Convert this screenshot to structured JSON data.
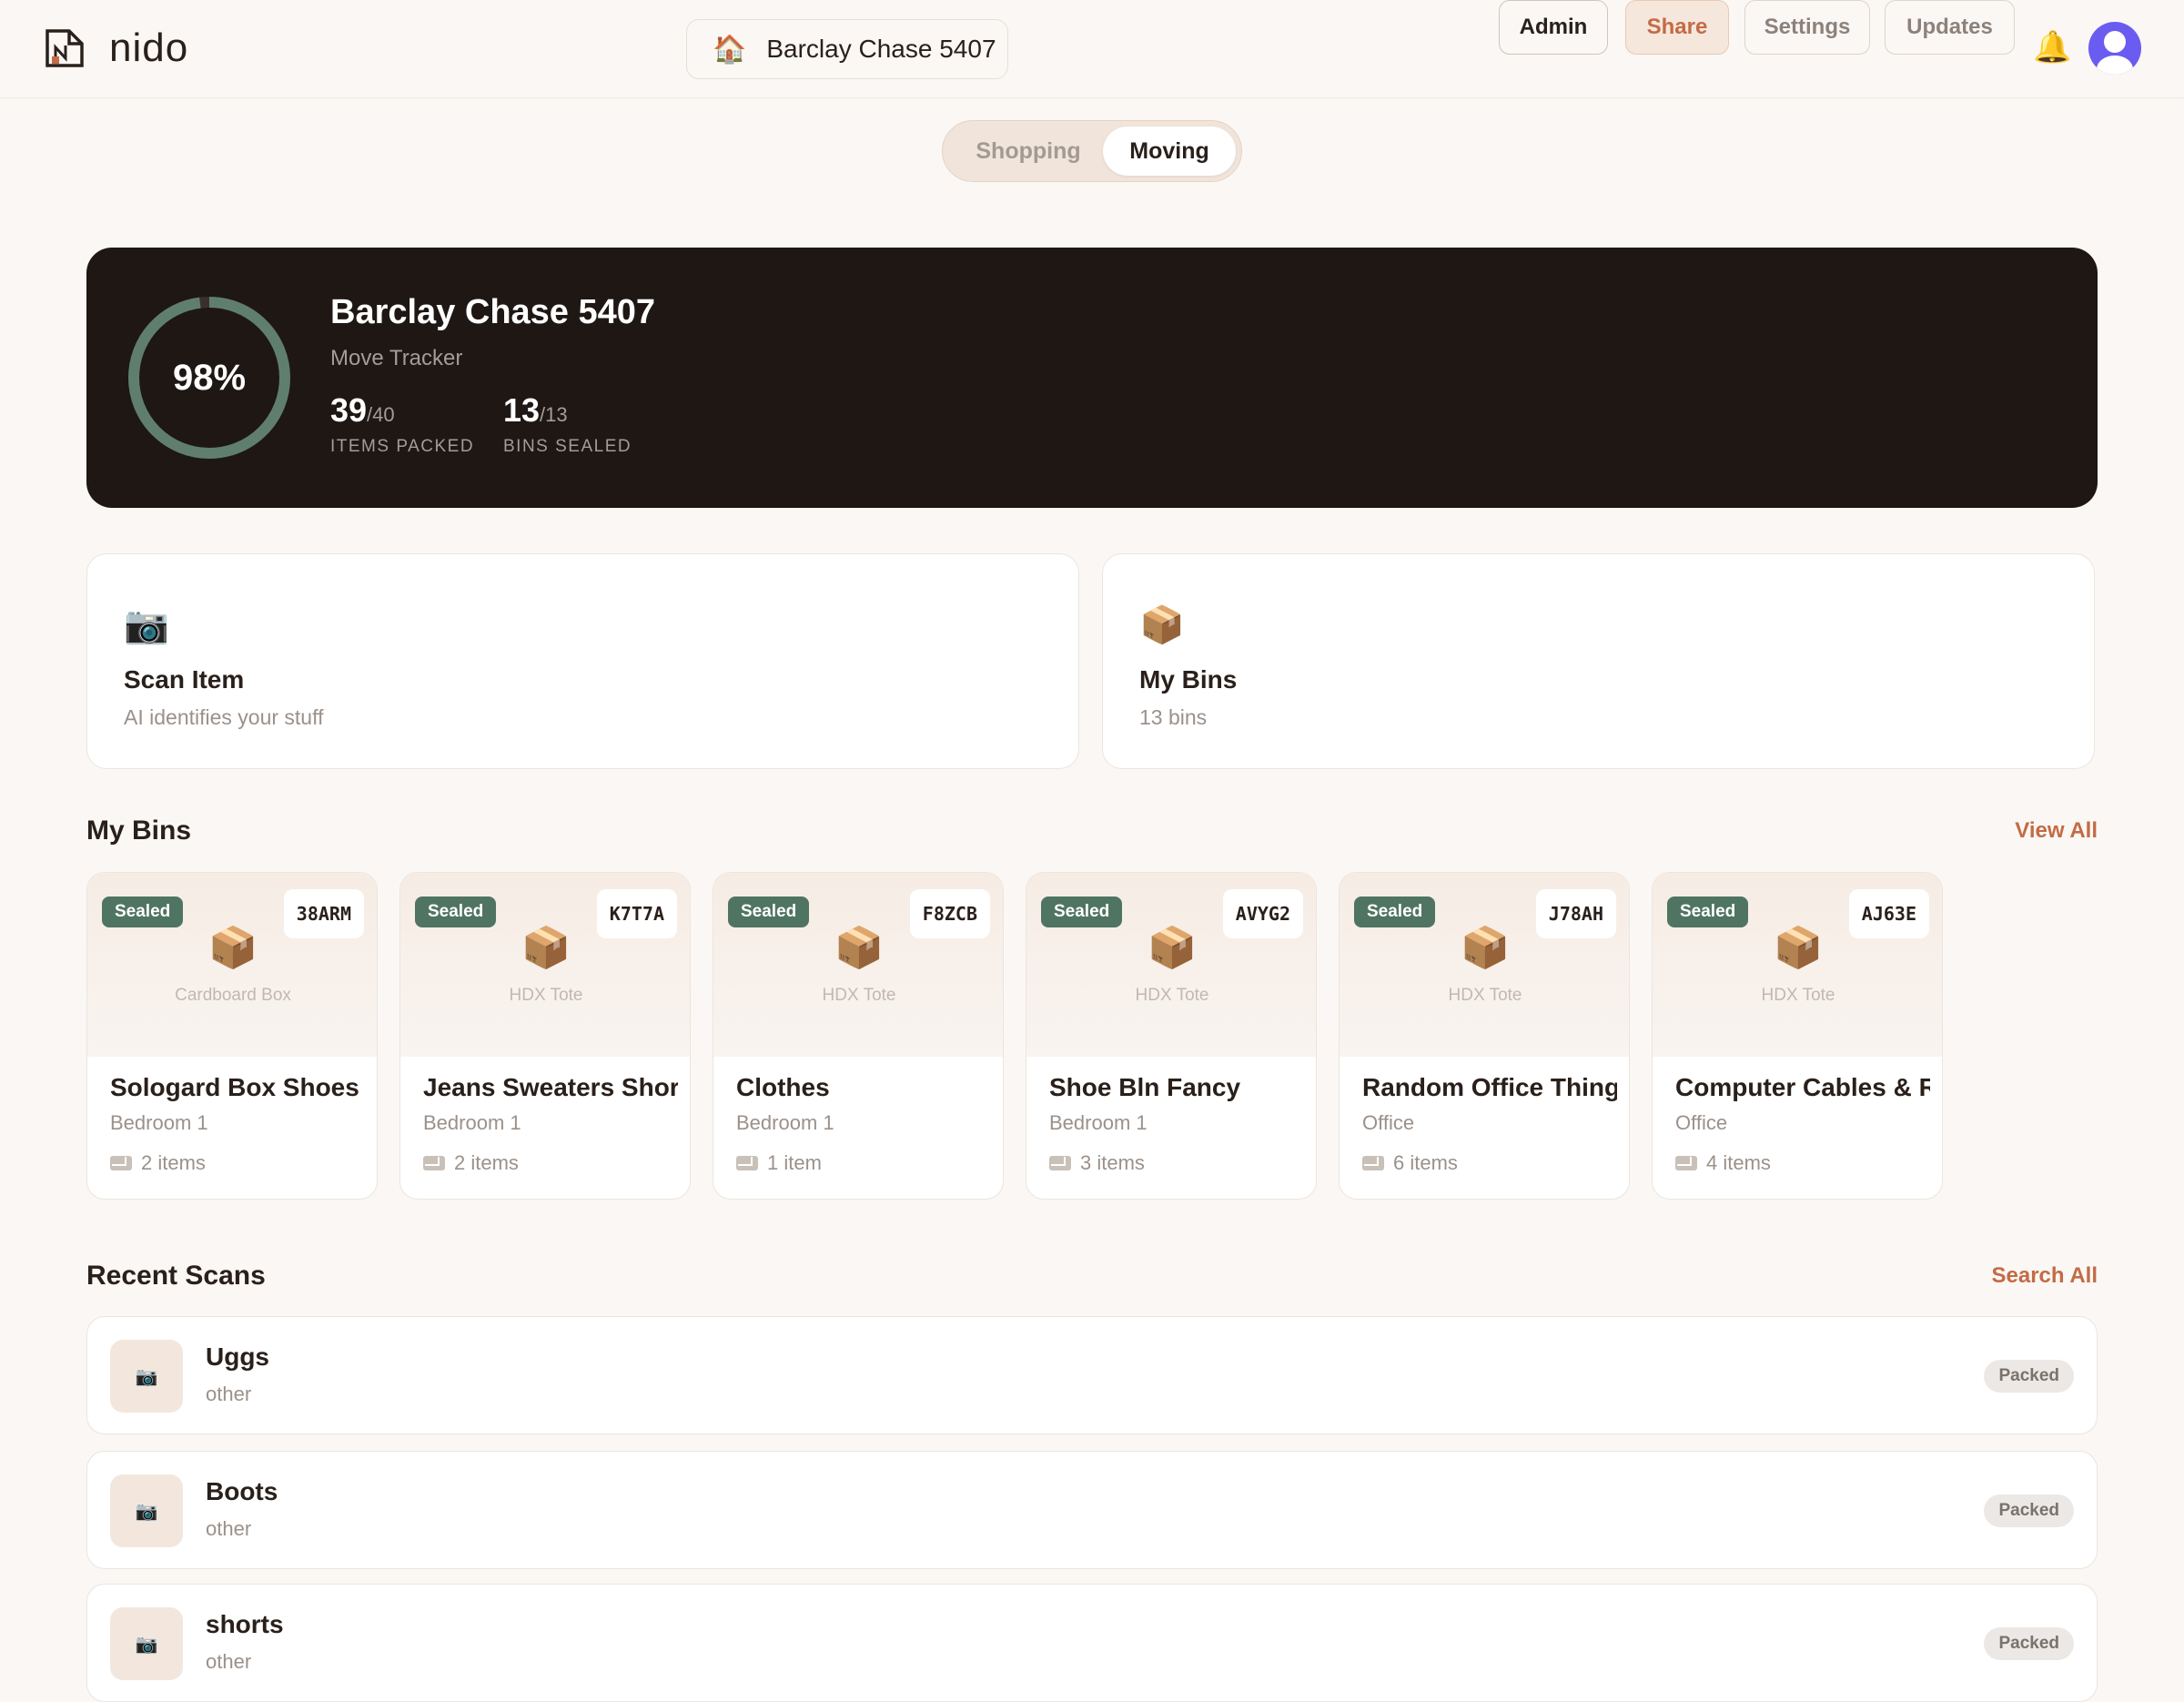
{
  "app": {
    "name": "nido"
  },
  "home": {
    "name": "Barclay Chase 5407",
    "icon": "house-icon"
  },
  "nav": {
    "admin": "Admin",
    "share": "Share",
    "settings": "Settings",
    "updates": "Updates"
  },
  "mode": {
    "options": [
      "Shopping",
      "Moving"
    ],
    "selected": "Moving"
  },
  "hero": {
    "percent_label": "98%",
    "percent": 0.98,
    "title": "Barclay Chase 5407",
    "subtitle": "Move Tracker",
    "items_packed": "39",
    "items_total": "/40",
    "items_caption": "ITEMS PACKED",
    "bins_sealed": "13",
    "bins_total": "/13",
    "bins_caption": "BINS SEALED"
  },
  "actions": [
    {
      "title": "Scan Item",
      "subtitle": "AI identifies your stuff",
      "icon": "camera-icon"
    },
    {
      "title": "My Bins",
      "subtitle": "13 bins",
      "icon": "box-icon"
    }
  ],
  "bins_section": {
    "title": "My Bins",
    "link": "View All"
  },
  "bins": [
    {
      "status": "Sealed",
      "code": "38ARM",
      "type": "Cardboard Box",
      "name": "Sologard Box Shoes",
      "room": "Bedroom 1",
      "count": "2 items"
    },
    {
      "status": "Sealed",
      "code": "K7T7A",
      "type": "HDX Tote",
      "name": "Jeans Sweaters Shorts",
      "room": "Bedroom 1",
      "count": "2 items"
    },
    {
      "status": "Sealed",
      "code": "F8ZCB",
      "type": "HDX Tote",
      "name": "Clothes",
      "room": "Bedroom 1",
      "count": "1 item"
    },
    {
      "status": "Sealed",
      "code": "AVYG2",
      "type": "HDX Tote",
      "name": "Shoe Bln Fancy",
      "room": "Bedroom 1",
      "count": "3 items"
    },
    {
      "status": "Sealed",
      "code": "J78AH",
      "type": "HDX Tote",
      "name": "Random Office Things",
      "room": "Office",
      "count": "6 items"
    },
    {
      "status": "Sealed",
      "code": "AJ63E",
      "type": "HDX Tote",
      "name": "Computer Cables & Routers",
      "room": "Office",
      "count": "4 items"
    }
  ],
  "scans_section": {
    "title": "Recent Scans",
    "link": "Search All"
  },
  "scans": [
    {
      "name": "Uggs",
      "category": "other",
      "status": "Packed"
    },
    {
      "name": "Boots",
      "category": "other",
      "status": "Packed"
    },
    {
      "name": "shorts",
      "category": "other",
      "status": "Packed"
    }
  ],
  "colors": {
    "accent": "#c36b46",
    "sealed": "#4f7562",
    "hero_bg": "#1e1714",
    "ring": "#5f7f6c",
    "avatar": "#6a5cf0"
  }
}
